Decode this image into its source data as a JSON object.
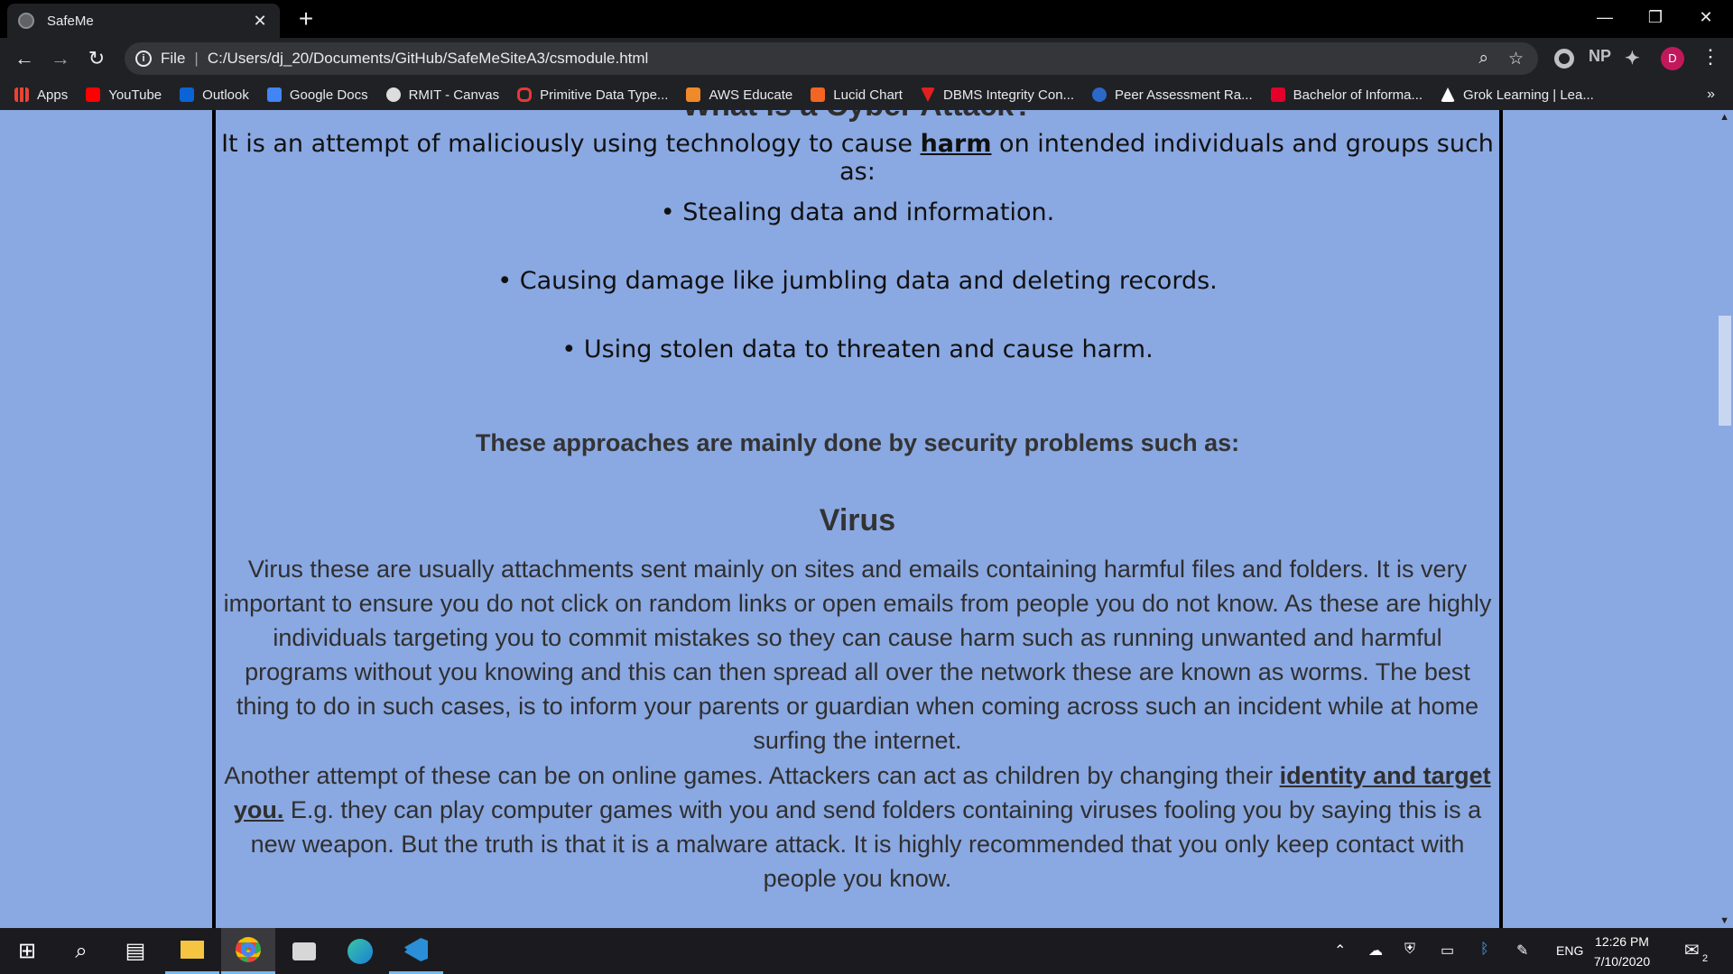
{
  "browser": {
    "tab_title": "SafeMe",
    "tab_close": "✕",
    "new_tab": "+",
    "address_prefix": "File",
    "address_sep": "|",
    "address_url": "C:/Users/dj_20/Documents/GitHub/SafeMeSiteA3/csmodule.html",
    "profile_initial": "D",
    "ext_np": "NP",
    "bookmarks": [
      {
        "label": "Apps",
        "color": "#ea4335"
      },
      {
        "label": "YouTube",
        "color": "#ff0000"
      },
      {
        "label": "Outlook",
        "color": "#0a64d6"
      },
      {
        "label": "Google Docs",
        "color": "#4285f4"
      },
      {
        "label": "RMIT - Canvas",
        "color": "#dddddd"
      },
      {
        "label": "Primitive Data Type...",
        "color": "#e53935"
      },
      {
        "label": "AWS Educate",
        "color": "#f0892a"
      },
      {
        "label": "Lucid Chart",
        "color": "#f26522"
      },
      {
        "label": "DBMS Integrity Con...",
        "color": "#e02020"
      },
      {
        "label": "Peer Assessment Ra...",
        "color": "#2b68c8"
      },
      {
        "label": "Bachelor of Informa...",
        "color": "#e4002b"
      },
      {
        "label": "Grok Learning | Lea...",
        "color": "#ffffff"
      }
    ],
    "bookmarks_more": "»"
  },
  "page": {
    "clipped_heading": "What is a Cyber Attack?",
    "intro_before": "It is an attempt of maliciously using technology to cause ",
    "intro_link": "harm",
    "intro_after": " on intended individuals and groups such as:",
    "bullets": [
      "• Stealing data and information.",
      "• Causing damage like jumbling data and deleting records.",
      "• Using stolen data to threaten and cause harm."
    ],
    "approaches": "These approaches are mainly done by security problems such as:",
    "virus_title": "Virus",
    "virus_para": "Virus these are usually attachments sent mainly on sites and emails containing harmful files and folders. It is very important to ensure you do not click on random links or open emails from people you do not know. As these are highly individuals targeting you to commit mistakes so they can cause harm such as running unwanted and harmful programs without you knowing and this can then spread all over the network these are known as worms. The best thing to do in such cases, is to inform your parents or guardian when coming across such an incident while at home surfing the internet.",
    "games_before": "Another attempt of these can be on online games. Attackers can act as children by changing their ",
    "games_link": "identity and target you.",
    "games_after": " E.g. they can play computer games with you and send folders containing viruses fooling you by saying this is a new weapon. But the truth is that it is a malware attack. It is highly recommended that you only keep contact with people you know."
  },
  "taskbar": {
    "language": "ENG",
    "time": "12:26 PM",
    "date": "7/10/2020",
    "notifications": "2"
  }
}
